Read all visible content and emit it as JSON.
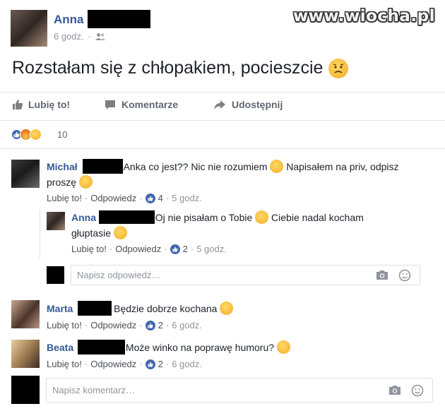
{
  "watermark": "www.wiocha.pl",
  "post": {
    "author": "Anna",
    "time": "6 godz.",
    "audience_icon": "friends-icon",
    "text": "Rozstałam się z chłopakiem, pocieszcie",
    "emoji": "worried-face"
  },
  "actions": {
    "like": "Lubię to!",
    "comment": "Komentarze",
    "share": "Udostępnij"
  },
  "reactions": {
    "types": [
      "like",
      "angry",
      "sad"
    ],
    "count": "10"
  },
  "comments": [
    {
      "author": "Michał",
      "text_a": "Anka co jest?? Nic nie rozumiem",
      "text_b": "Napisałem na priv, odpisz",
      "text_c": "proszę",
      "like": "Lubię to!",
      "reply": "Odpowiedz",
      "likes": "4",
      "time": "5 godz.",
      "reply_item": {
        "author": "Anna",
        "text_a": "Oj nie pisałam o Tobie",
        "text_b": "Ciebie nadal kocham",
        "text_c": "głuptasie",
        "like": "Lubię to!",
        "reply": "Odpowiedz",
        "likes": "2",
        "time": "5 godz."
      },
      "reply_placeholder": "Napisz odpowiedź…"
    },
    {
      "author": "Marta",
      "text_a": "Będzie dobrze kochana",
      "like": "Lubię to!",
      "reply": "Odpowiedz",
      "likes": "2",
      "time": "6 godz."
    },
    {
      "author": "Beata",
      "text_a": "Może winko na poprawę humoru?",
      "like": "Lubię to!",
      "reply": "Odpowiedz",
      "likes": "2",
      "time": "6 godz."
    }
  ],
  "comment_placeholder": "Napisz komentarz…",
  "colors": {
    "fb_blue": "#365899",
    "like_blue": "#4267b2",
    "angry_orange": "#e9710f",
    "emoji_yellow": "#f7b733"
  }
}
